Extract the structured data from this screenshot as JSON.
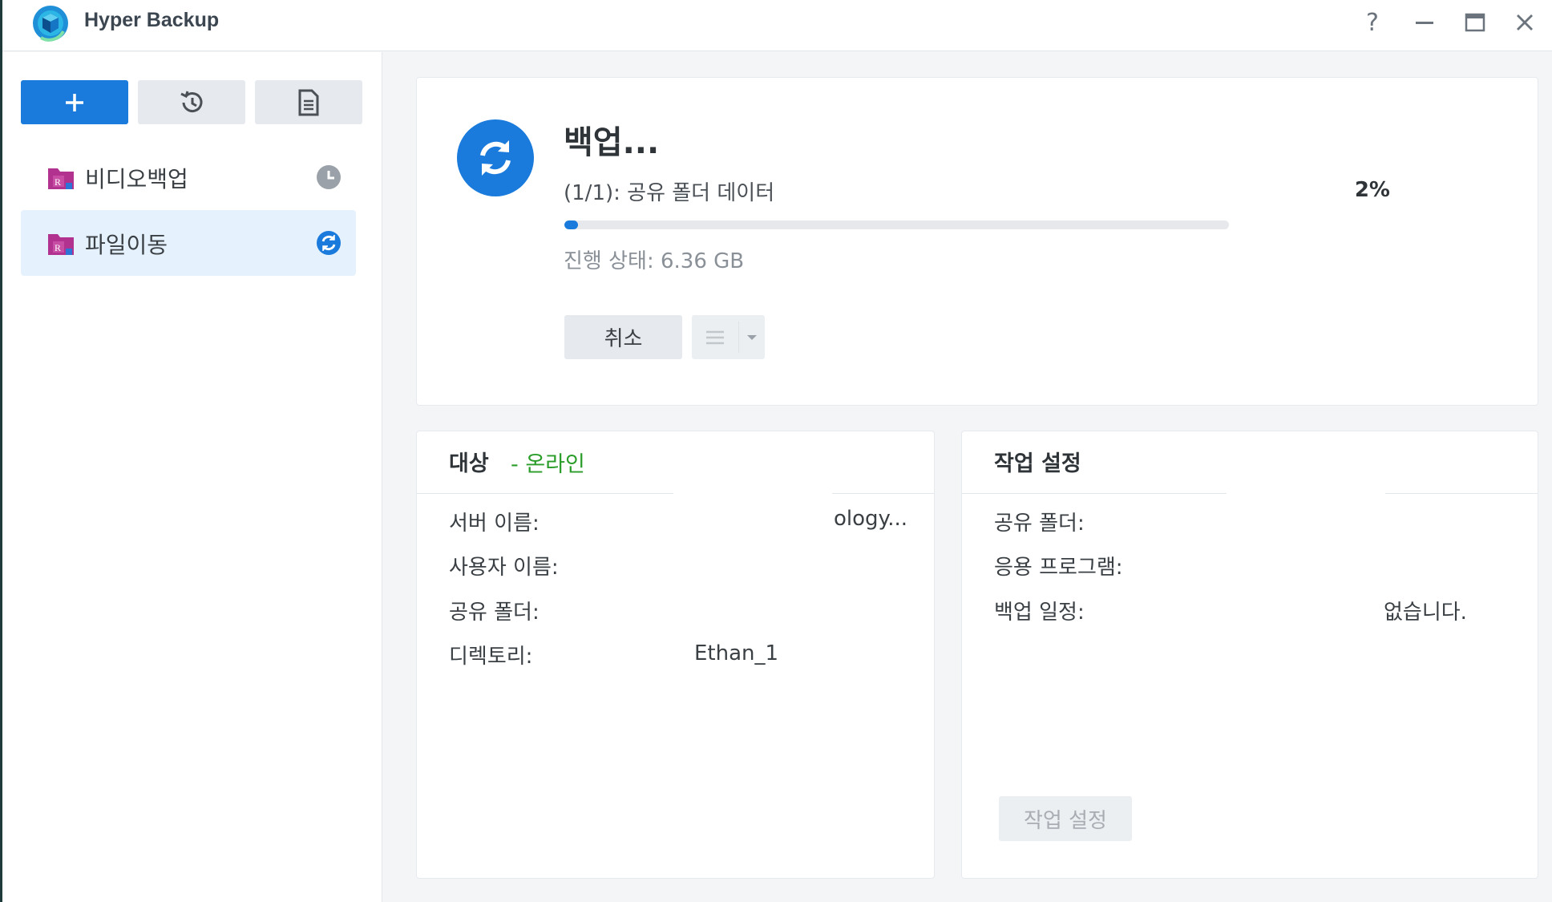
{
  "window": {
    "title": "Hyper Backup",
    "controls": {
      "help": "?",
      "minimize_icon": "minimize-icon",
      "maximize_icon": "maximize-icon",
      "close_icon": "close-icon"
    }
  },
  "sidebar": {
    "toolbar": [
      {
        "icon": "plus-icon"
      },
      {
        "icon": "history-icon"
      },
      {
        "icon": "log-document-icon"
      }
    ],
    "tasks": [
      {
        "label": "비디오백업",
        "status_icon": "clock-icon"
      },
      {
        "label": "파일이동",
        "status_icon": "syncing-icon",
        "selected": true
      }
    ]
  },
  "progress": {
    "title": "백업...",
    "subtitle": "(1/1): 공유 폴더 데이터",
    "percent_label": "2%",
    "percent": 2,
    "state": "진행 상태: 6.36 GB",
    "cancel_label": "취소",
    "accent": "#1a7bdc"
  },
  "destination": {
    "title": "대상",
    "status": "- 온라인",
    "rows": [
      {
        "label": "서버 이름:",
        "value": "ology..."
      },
      {
        "label": "사용자 이름:",
        "value": ""
      },
      {
        "label": "공유 폴더:",
        "value": ""
      },
      {
        "label": "디렉토리:",
        "value": "Ethan_1"
      }
    ]
  },
  "task_settings": {
    "title": "작업 설정",
    "rows": [
      {
        "label": "공유 폴더:",
        "value": ""
      },
      {
        "label": "응용 프로그램:",
        "value": ""
      },
      {
        "label": "백업 일정:",
        "value": "없습니다."
      }
    ],
    "button_label": "작업 설정"
  }
}
